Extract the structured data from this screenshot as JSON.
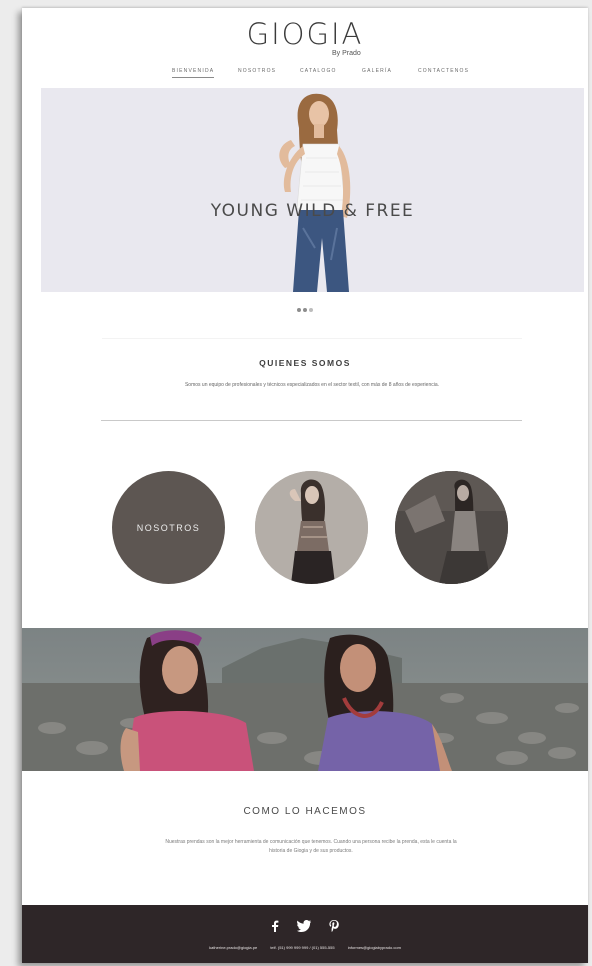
{
  "header": {
    "logo_main": "GIOGIA",
    "logo_sub": "By Prado"
  },
  "nav": {
    "items": [
      {
        "label": "BIENVENIDA",
        "active": true
      },
      {
        "label": "NOSOTROS"
      },
      {
        "label": "CATALOGO"
      },
      {
        "label": "GALERÍA"
      },
      {
        "label": "CONTACTENOS"
      }
    ]
  },
  "hero": {
    "title": "YOUNG WILD & FREE",
    "slides_total": 3,
    "active_slide": 1
  },
  "about": {
    "title": "QUIENES SOMOS",
    "text": "Somos un equipo de profesionales y técnicos especializados en el sector textil, con más de 8 años de experiencia."
  },
  "circles": {
    "first_label": "NOSOTROS"
  },
  "how": {
    "title": "COMO LO HACEMOS",
    "text": "Nuestras prendas son la mejor herramienta de comunicación que tenemos. Cuando una persona recibe la prenda, esta le cuenta la historia de Giogia y de sus productos."
  },
  "footer": {
    "social": [
      "facebook-icon",
      "twitter-icon",
      "pinterest-icon"
    ],
    "email": "katherine.prado@giogia.pe",
    "phone": "telf. (51) 999 999 999 / (01) 555-555",
    "email2": "informes@giogiabyprado.com"
  },
  "colors": {
    "footer_bg": "#2e2628",
    "circle_dark": "#5d5652"
  }
}
